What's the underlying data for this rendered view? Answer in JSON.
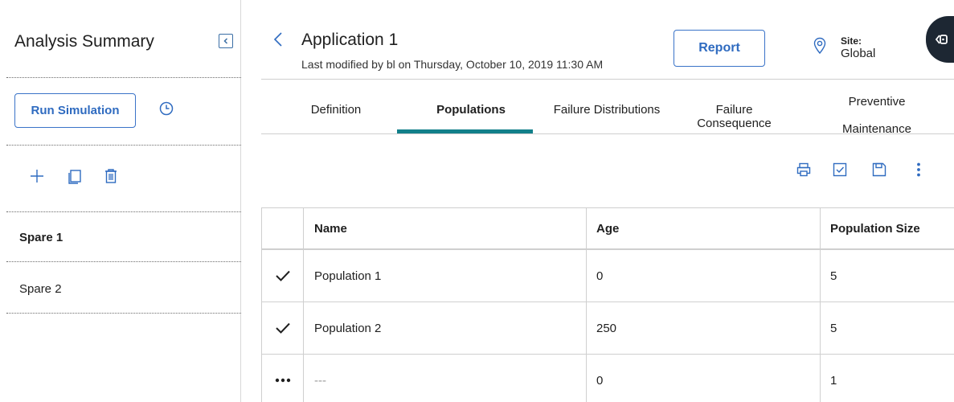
{
  "sidebar": {
    "title": "Analysis Summary",
    "run_simulation_label": "Run Simulation",
    "items": [
      {
        "label": "Spare 1",
        "selected": true
      },
      {
        "label": "Spare 2",
        "selected": false
      }
    ],
    "icons": [
      "collapse-panel-icon",
      "history-icon",
      "add-icon",
      "copy-icon",
      "delete-icon"
    ]
  },
  "header": {
    "title": "Application 1",
    "subtitle": "Last modified by bl on Thursday, October 10, 2019 11:30 AM",
    "report_label": "Report",
    "site_label": "Site:",
    "site_value": "Global"
  },
  "tabs": [
    {
      "label": "Definition",
      "active": false
    },
    {
      "label": "Populations",
      "active": true
    },
    {
      "label": "Failure Distributions",
      "active": false
    },
    {
      "label": "Failure Consequence",
      "active": false
    },
    {
      "label": "Preventive",
      "label2": "Maintenance",
      "active": false
    }
  ],
  "toolbar_icons": [
    "print-icon",
    "check-icon",
    "save-icon",
    "more-vertical-icon"
  ],
  "table": {
    "columns": [
      "Name",
      "Age",
      "Population Size"
    ],
    "rows": [
      {
        "marker": "check",
        "name": "Population 1",
        "age": "0",
        "size": "5"
      },
      {
        "marker": "check",
        "name": "Population 2",
        "age": "250",
        "size": "5"
      },
      {
        "marker": "more",
        "name": "---",
        "age": "0",
        "size": "1"
      }
    ]
  },
  "colors": {
    "accent": "#2f6bc0",
    "tab_underline": "#12808a",
    "side_tab": "#1d2733"
  }
}
